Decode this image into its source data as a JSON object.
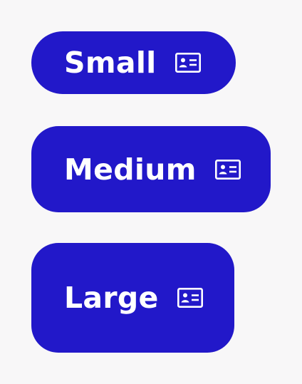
{
  "buttons": {
    "small": {
      "label": "Small",
      "icon": "contact-card-icon"
    },
    "medium": {
      "label": "Medium",
      "icon": "contact-card-icon"
    },
    "large": {
      "label": "Large",
      "icon": "contact-card-icon"
    }
  },
  "colors": {
    "background": "#f8f7f8",
    "button": "#2218c9",
    "text": "#ffffff"
  }
}
